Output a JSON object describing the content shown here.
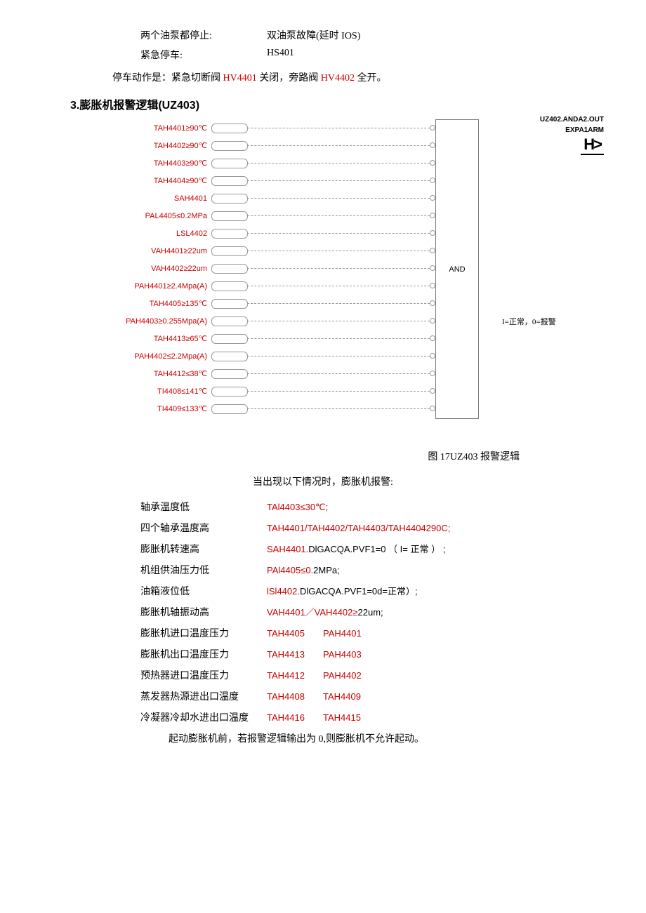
{
  "top": {
    "rows": [
      {
        "label": "两个油泵都停止:",
        "value": "双油泵故障(延时 IOS)"
      },
      {
        "label": "紧急停车:",
        "value": "HS401"
      }
    ],
    "sentence_pre": "停车动作是：紧急切断阀 ",
    "hv1": "HV4401",
    "sentence_mid": " 关闭，旁路阀 ",
    "hv2": "HV4402",
    "sentence_post": " 全开。"
  },
  "heading": "3.膨胀机报警逻辑(UZ403)",
  "diagram": {
    "inputs": [
      "TAH4401≥90℃",
      "TAH4402≥90℃",
      "TAH4403≥90℃",
      "TAH4404≥90℃",
      "SAH4401",
      "PAL4405≤0.2MPa",
      "LSL4402",
      "VAH4401≥22um",
      "VAH4402≥22um",
      "PAH4401≥2.4Mpa(A)",
      "TAH4405≥135℃",
      "PAH4403≥0.255Mpa(A)",
      "TAH4413≥65℃",
      "PAH4402≤2.2Mpa(A)",
      "TAH4412≤38℃",
      "TI4408≤141℃",
      "TI4409≤133℃"
    ],
    "and": "AND",
    "out1": "UZ402.ANDA2.OUT",
    "out2": "EXPA1ARM",
    "hsym": "H>",
    "legend": "I=正常，0=报警"
  },
  "caption": "图 17UZ403 报警逻辑",
  "alarm_intro": "当出现以下情况时，膨胀机报警:",
  "alarms": [
    {
      "label": "轴承温度低",
      "val": "TAl4403≤30℃;",
      "black": ""
    },
    {
      "label": "四个轴承温度高",
      "val": "TAH4401/TAH4402/TAH4403/TAH4404290C;",
      "black": ""
    },
    {
      "label": "膨胀机转速高",
      "val": "SAH4401.",
      "black": "DlGACQA.PVF1=0 （ I= 正常 ） ;"
    },
    {
      "label": "机组供油压力低",
      "val": "PAl4405≤0.",
      "black": "2MPa;"
    },
    {
      "label": "油箱液位低",
      "val": "lSl4402.",
      "black": "DlGACQA.PVF1=0d=正常）;"
    },
    {
      "label": "膨胀机轴振动高",
      "val": "VAH4401／VAH4402≥",
      "black": "22um;"
    }
  ],
  "alarms2": [
    {
      "label": "膨胀机进口温度压力",
      "v1": "TAH4405",
      "v2": "PAH4401"
    },
    {
      "label": "膨胀机出口温度压力",
      "v1": "TAH4413",
      "v2": "PAH4403"
    },
    {
      "label": "预热器进口温度压力",
      "v1": "TAH4412",
      "v2": "PAH4402"
    },
    {
      "label": "蒸发器热源进出口温度",
      "v1": "TAH4408",
      "v2": "TAH4409"
    },
    {
      "label": "冷凝器冷却水进出口温度",
      "v1": "TAH4416",
      "v2": "TAH4415"
    }
  ],
  "footnote": "起动膨胀机前，若报警逻辑输出为 0,则膨胀机不允许起动。"
}
